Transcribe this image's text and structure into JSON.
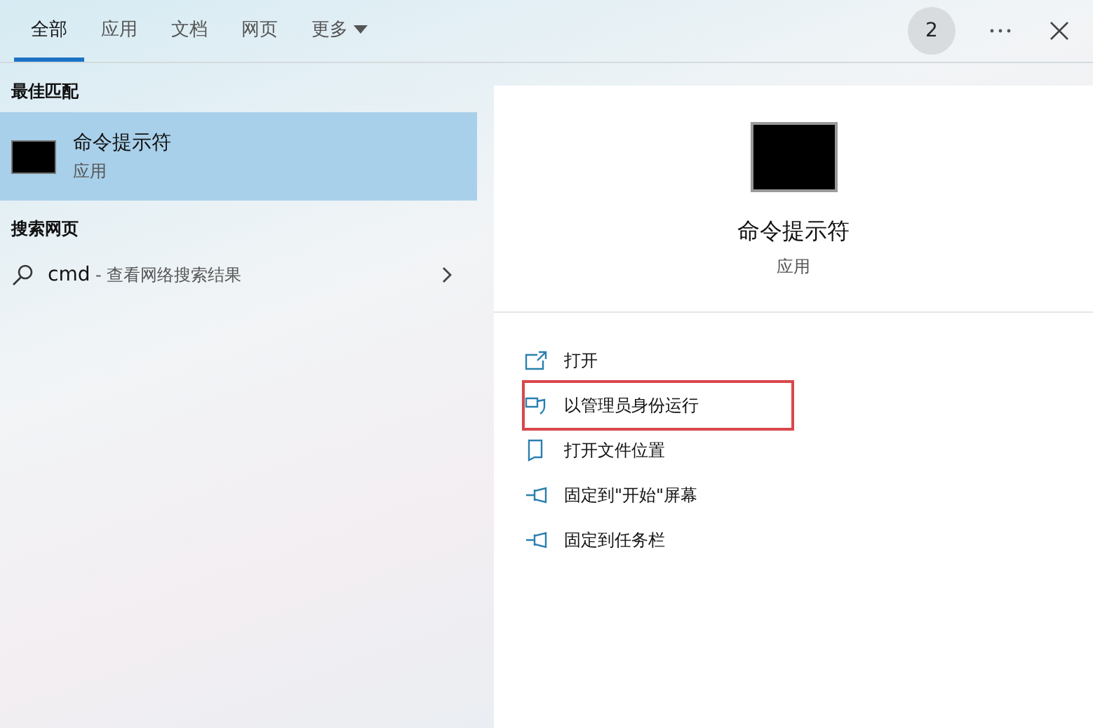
{
  "tabs": [
    {
      "label": "全部",
      "selected": true,
      "dropdown": false
    },
    {
      "label": "应用",
      "selected": false,
      "dropdown": false
    },
    {
      "label": "文档",
      "selected": false,
      "dropdown": false
    },
    {
      "label": "网页",
      "selected": false,
      "dropdown": false
    },
    {
      "label": "更多",
      "selected": false,
      "dropdown": true
    }
  ],
  "badge": "2",
  "best_match": {
    "heading": "最佳匹配",
    "title": "命令提示符",
    "subtitle": "应用",
    "selected": true
  },
  "web_search": {
    "heading": "搜索网页",
    "query": "cmd",
    "suffix": " - 查看网络搜索结果"
  },
  "details": {
    "title": "命令提示符",
    "subtitle": "应用"
  },
  "actions": [
    {
      "kind": "open",
      "label": "打开",
      "highlighted": false
    },
    {
      "kind": "admin",
      "label": "以管理员身份运行",
      "highlighted": true
    },
    {
      "kind": "folder",
      "label": "打开文件位置",
      "highlighted": false
    },
    {
      "kind": "pin",
      "label": "固定到\"开始\"屏幕",
      "highlighted": false
    },
    {
      "kind": "pin",
      "label": "固定到任务栏",
      "highlighted": false
    }
  ]
}
